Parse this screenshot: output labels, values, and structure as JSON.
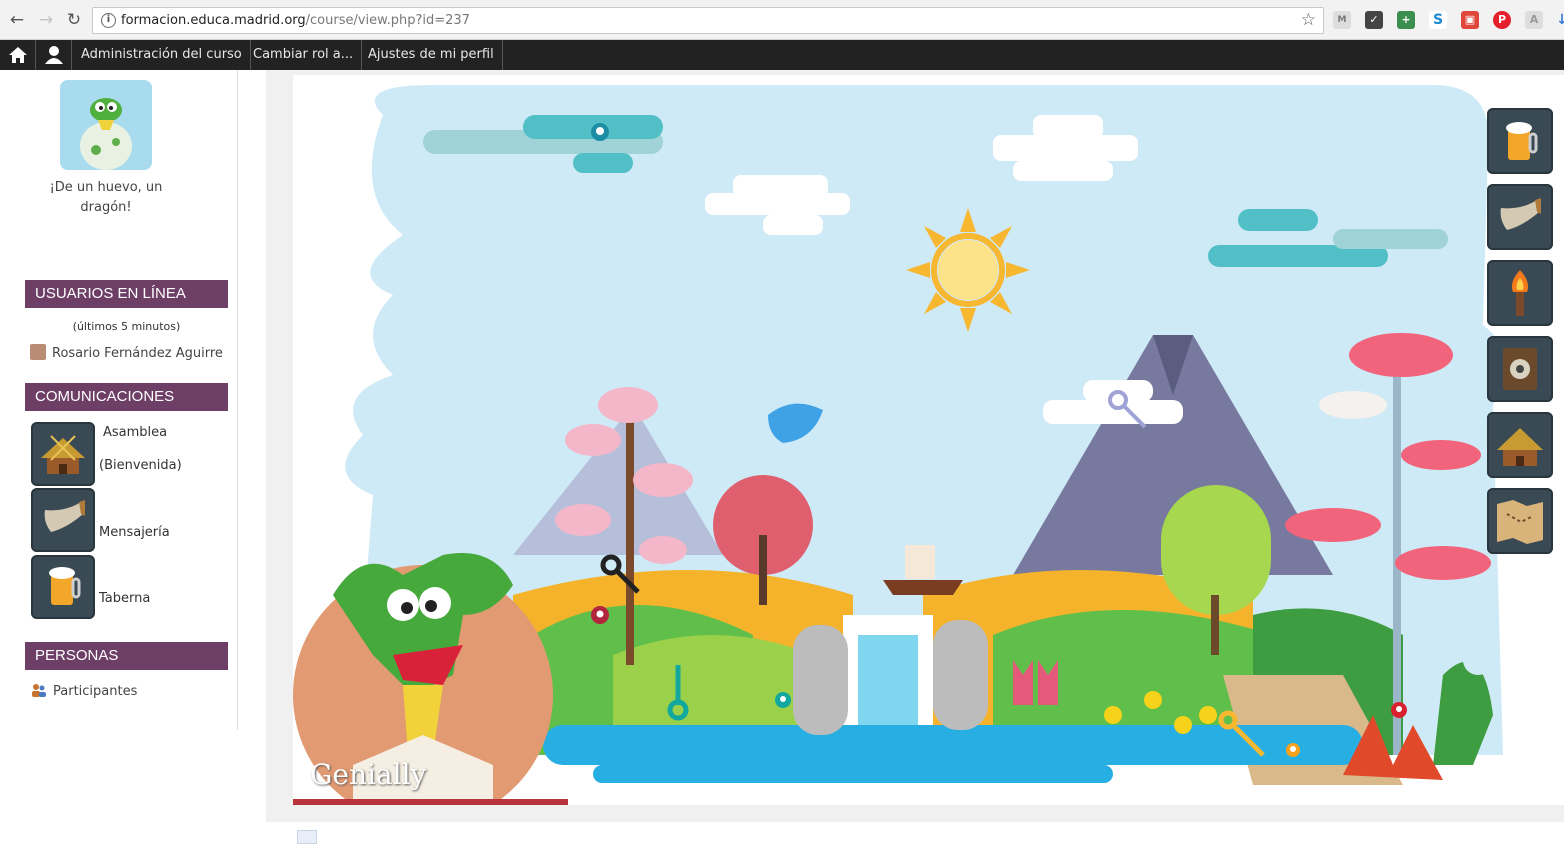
{
  "browser": {
    "url_host": "formacion.educa.madrid.org",
    "url_path": "/course/view.php?id=237"
  },
  "navbar": {
    "items": [
      "Administración del curso",
      "Cambiar rol a...",
      "Ajustes de mi perfil"
    ]
  },
  "sidebar": {
    "course_caption": "¡De un huevo, un dragón!",
    "online_block": {
      "title": "USUARIOS EN LÍNEA",
      "note": "(últimos 5 minutos)",
      "users": [
        "Rosario Fernández Aguirre"
      ]
    },
    "comms_block": {
      "title": "COMUNICACIONES",
      "items": [
        "Asamblea",
        "(Bienvenida)",
        "Mensajería",
        "Taberna"
      ]
    },
    "people_block": {
      "title": "PERSONAS",
      "items": [
        "Participantes"
      ]
    }
  },
  "genially": {
    "watermark": "Genially"
  },
  "colors": {
    "block_header": "#6d3f66",
    "navbar": "#222222",
    "sky": "#cfeaf7"
  }
}
